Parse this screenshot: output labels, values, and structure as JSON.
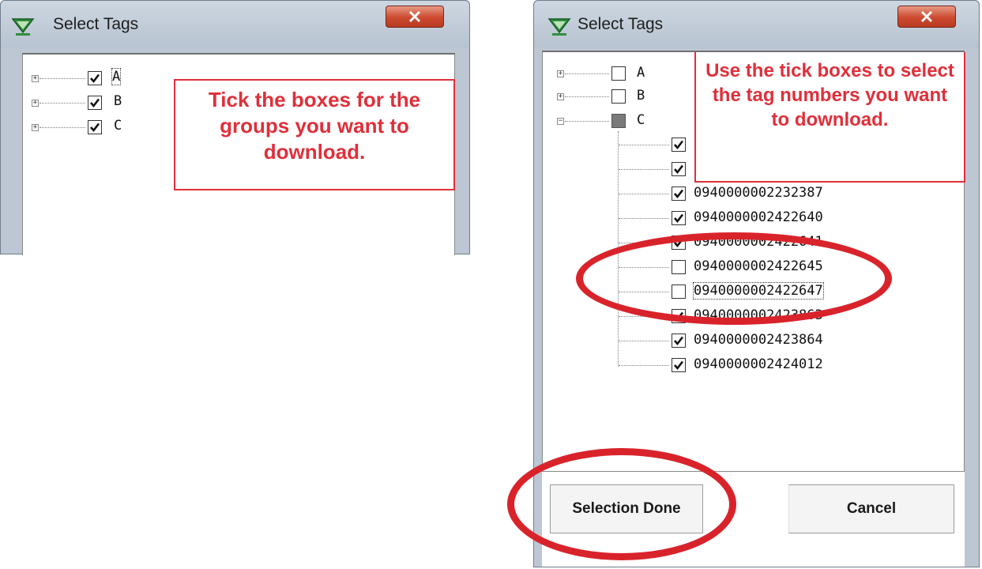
{
  "left_dialog": {
    "title": "Select Tags",
    "tree": [
      {
        "label": "A",
        "checked": true
      },
      {
        "label": "B",
        "checked": true
      },
      {
        "label": "C",
        "checked": true
      }
    ],
    "callout": "Tick the boxes for the groups you want to download."
  },
  "right_dialog": {
    "title": "Select Tags",
    "groups": [
      {
        "label": "A",
        "state": "unchecked"
      },
      {
        "label": "B",
        "state": "unchecked"
      },
      {
        "label": "C",
        "state": "partial"
      }
    ],
    "tags": [
      {
        "label": "",
        "checked": true
      },
      {
        "label": "",
        "checked": true
      },
      {
        "label": "0940000002232387",
        "checked": true
      },
      {
        "label": "0940000002422640",
        "checked": true
      },
      {
        "label": "0940000002422641",
        "checked": true
      },
      {
        "label": "0940000002422645",
        "checked": false
      },
      {
        "label": "0940000002422647",
        "checked": false
      },
      {
        "label": "0940000002423863",
        "checked": true
      },
      {
        "label": "0940000002423864",
        "checked": true
      },
      {
        "label": "0940000002424012",
        "checked": true
      }
    ],
    "callout": "Use the tick boxes to select the tag numbers you want to download.",
    "buttons": {
      "selection_done": "Selection Done",
      "cancel": "Cancel"
    }
  },
  "colors": {
    "annotation_red": "#e02f3a",
    "window_frame": "#bcc7d3",
    "close_button": "#cc4a2f"
  }
}
